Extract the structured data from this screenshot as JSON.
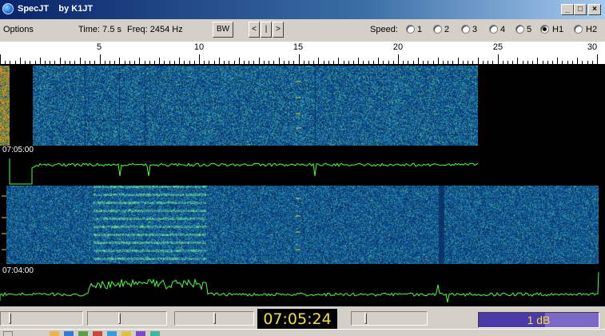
{
  "window": {
    "title": "SpecJT    by K1JT",
    "minimize": "_",
    "maximize": "□",
    "close": "×"
  },
  "toolbar": {
    "options": "Options",
    "time": "Time:  7.5 s",
    "freq": "Freq: 2454 Hz",
    "bw_button": "BW",
    "prev_button": "<",
    "mid_button": "|",
    "next_button": ">",
    "speed_label": "Speed:",
    "speed_options": [
      "1",
      "2",
      "3",
      "4",
      "5",
      "H1",
      "H2"
    ],
    "speed_selected": "H1"
  },
  "ruler": {
    "labels": [
      "5",
      "10",
      "15",
      "20",
      "25",
      "30"
    ]
  },
  "waterfall": {
    "timestamp_top": "07:05:00",
    "timestamp_bottom": "07:04:00"
  },
  "status": {
    "clock": "07:05:24",
    "level": "1 dB",
    "level_fraction": 0.55
  },
  "colors": {
    "title_gradient_start": "#0a246a",
    "trace": "#4cff3c",
    "clock_text": "#f0e040",
    "level_bar": "#7b68c8"
  }
}
